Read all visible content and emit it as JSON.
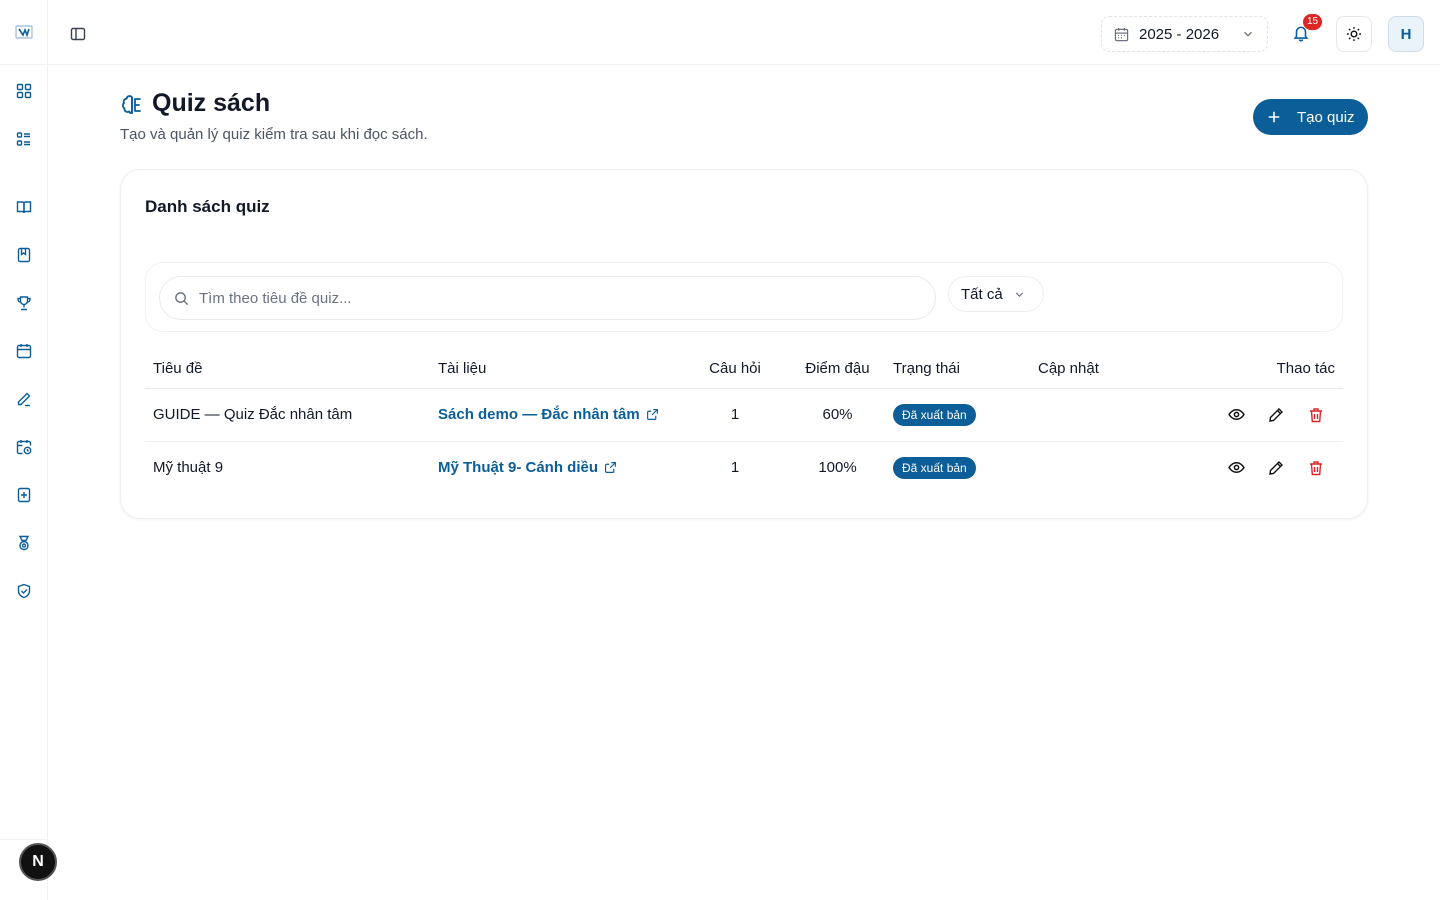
{
  "topbar": {
    "school_year": "2025 - 2026",
    "notification_count": "15",
    "avatar_initial": "H"
  },
  "sidebar": {
    "icons": [
      "dashboard-icon",
      "list-icon",
      "book-open-icon",
      "book-icon",
      "trophy-icon",
      "calendar-icon",
      "pen-icon",
      "calendar-clock-icon",
      "book-plus-icon",
      "medal-icon",
      "shield-check-icon"
    ],
    "footer_badge": "N"
  },
  "header": {
    "title": "Quiz sách",
    "subtitle": "Tạo và quản lý quiz kiểm tra sau khi đọc sách.",
    "create_label": "Tạo quiz"
  },
  "card": {
    "title": "Danh sách quiz",
    "search_placeholder": "Tìm theo tiêu đề quiz...",
    "status_filter": "Tất cả"
  },
  "table": {
    "columns": {
      "title": "Tiêu đề",
      "document": "Tài liệu",
      "questions": "Câu hỏi",
      "pass_score": "Điểm đậu",
      "status": "Trạng thái",
      "updated": "Cập nhật",
      "actions": "Thao tác"
    },
    "rows": [
      {
        "title": "GUIDE — Quiz Đắc nhân tâm",
        "document": "Sách demo — Đắc nhân tâm",
        "questions": "1",
        "pass_score": "60%",
        "status": "Đã xuất bản",
        "updated": ""
      },
      {
        "title": "Mỹ thuật 9",
        "document": "Mỹ Thuật 9- Cánh diều",
        "questions": "1",
        "pass_score": "100%",
        "status": "Đã xuất bản",
        "updated": ""
      }
    ]
  },
  "colors": {
    "primary": "#0b5e98",
    "danger": "#dc2626"
  }
}
